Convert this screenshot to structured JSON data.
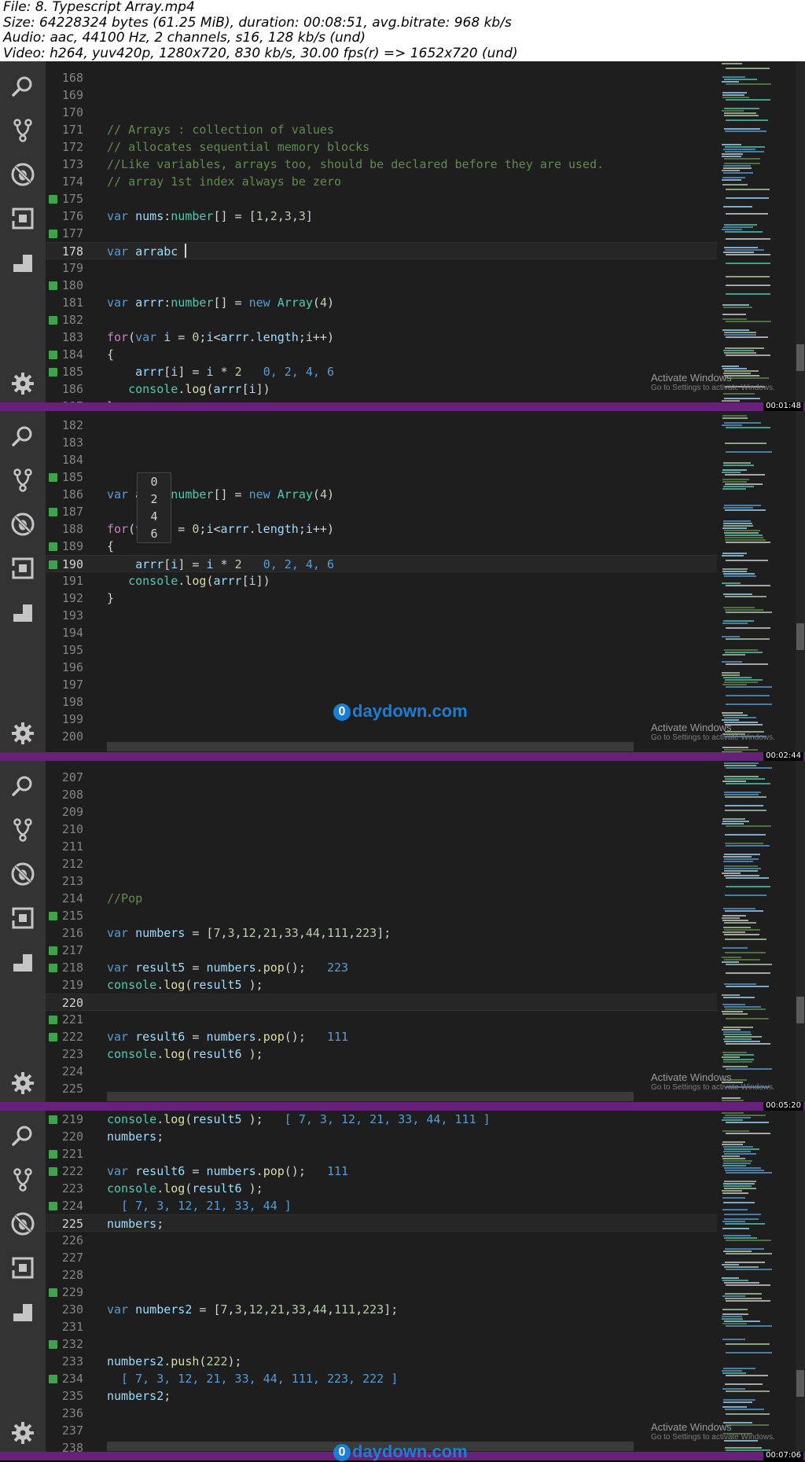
{
  "file_info": [
    "File: 8. Typescript Array.mp4",
    "Size: 64228324 bytes (61.25 MiB), duration: 00:08:51, avg.bitrate: 968 kb/s",
    "Audio: aac, 44100 Hz, 2 channels, s16, 128 kb/s (und)",
    "Video: h264, yuv420p, 1280x720, 830 kb/s, 30.00 fps(r) => 1652x720 (und)"
  ],
  "activity_icons": [
    "explorer-icon",
    "source-control-icon",
    "debug-icon",
    "extensions-icon",
    "layout-icon",
    "settings-icon"
  ],
  "watermark": {
    "line1": "Activate Windows",
    "line2": "Go to Settings to activate Windows."
  },
  "site_logo": {
    "mark": "0",
    "text": "daydown.com"
  },
  "panels": [
    {
      "timestamp": "00:01:48",
      "lines": [
        {
          "n": "168",
          "m": false,
          "t": ""
        },
        {
          "n": "169",
          "m": false,
          "t": ""
        },
        {
          "n": "170",
          "m": false,
          "t": ""
        },
        {
          "n": "171",
          "m": false,
          "t": "// Arrays : collection of values"
        },
        {
          "n": "172",
          "m": false,
          "t": "// allocates sequential memory blocks"
        },
        {
          "n": "173",
          "m": false,
          "t": "//Like variables, arrays too, should be declared before they are used."
        },
        {
          "n": "174",
          "m": false,
          "t": "// array 1st index always be zero"
        },
        {
          "n": "175",
          "m": true,
          "t": ""
        },
        {
          "n": "176",
          "m": false,
          "t": "var nums:number[] = [1,2,3,3]"
        },
        {
          "n": "177",
          "m": true,
          "t": ""
        },
        {
          "n": "178",
          "m": false,
          "t": "var arrabc "
        },
        {
          "n": "179",
          "m": false,
          "t": ""
        },
        {
          "n": "180",
          "m": true,
          "t": ""
        },
        {
          "n": "181",
          "m": false,
          "t": "var arrr:number[] = new Array(4)"
        },
        {
          "n": "182",
          "m": true,
          "t": ""
        },
        {
          "n": "183",
          "m": false,
          "t": "for(var i = 0;i<arrr.length;i++)"
        },
        {
          "n": "184",
          "m": true,
          "t": "{"
        },
        {
          "n": "185",
          "m": true,
          "t": "    arrr[i] = i * 2",
          "r": "0, 2, 4, 6"
        },
        {
          "n": "186",
          "m": false,
          "t": "   console.log(arrr[i])"
        },
        {
          "n": "187",
          "m": false,
          "t": "}"
        }
      ]
    },
    {
      "timestamp": "00:02:44",
      "popup_values": [
        "0",
        "2",
        "4",
        "6"
      ],
      "lines": [
        {
          "n": "182",
          "m": false,
          "t": ""
        },
        {
          "n": "183",
          "m": false,
          "t": ""
        },
        {
          "n": "184",
          "m": false,
          "t": ""
        },
        {
          "n": "185",
          "m": true,
          "t": ""
        },
        {
          "n": "186",
          "m": false,
          "t": "var arrr:number[] = new Array(4)"
        },
        {
          "n": "187",
          "m": true,
          "t": ""
        },
        {
          "n": "188",
          "m": false,
          "t": "for(var i = 0;i<arrr.length;i++)"
        },
        {
          "n": "189",
          "m": true,
          "t": "{"
        },
        {
          "n": "190",
          "m": true,
          "t": "    arrr[i] = i * 2",
          "r": "0, 2, 4, 6"
        },
        {
          "n": "191",
          "m": false,
          "t": "   console.log(arrr[i])"
        },
        {
          "n": "192",
          "m": false,
          "t": "}"
        },
        {
          "n": "193",
          "m": false,
          "t": ""
        },
        {
          "n": "194",
          "m": false,
          "t": ""
        },
        {
          "n": "195",
          "m": false,
          "t": ""
        },
        {
          "n": "196",
          "m": false,
          "t": ""
        },
        {
          "n": "197",
          "m": false,
          "t": ""
        },
        {
          "n": "198",
          "m": false,
          "t": ""
        },
        {
          "n": "199",
          "m": false,
          "t": ""
        },
        {
          "n": "200",
          "m": false,
          "t": ""
        }
      ]
    },
    {
      "timestamp": "00:05:20",
      "lines": [
        {
          "n": "207",
          "m": false,
          "t": ""
        },
        {
          "n": "208",
          "m": false,
          "t": ""
        },
        {
          "n": "209",
          "m": false,
          "t": ""
        },
        {
          "n": "210",
          "m": false,
          "t": ""
        },
        {
          "n": "211",
          "m": false,
          "t": ""
        },
        {
          "n": "212",
          "m": false,
          "t": ""
        },
        {
          "n": "213",
          "m": false,
          "t": ""
        },
        {
          "n": "214",
          "m": false,
          "t": "//Pop"
        },
        {
          "n": "215",
          "m": true,
          "t": ""
        },
        {
          "n": "216",
          "m": false,
          "t": "var numbers = [7,3,12,21,33,44,111,223];"
        },
        {
          "n": "217",
          "m": true,
          "t": ""
        },
        {
          "n": "218",
          "m": true,
          "t": "var result5 = numbers.pop();",
          "r": "223"
        },
        {
          "n": "219",
          "m": false,
          "t": "console.log(result5 );"
        },
        {
          "n": "220",
          "m": false,
          "t": ""
        },
        {
          "n": "221",
          "m": true,
          "t": ""
        },
        {
          "n": "222",
          "m": true,
          "t": "var result6 = numbers.pop();",
          "r": "111"
        },
        {
          "n": "223",
          "m": false,
          "t": "console.log(result6 );"
        },
        {
          "n": "224",
          "m": false,
          "t": ""
        },
        {
          "n": "225",
          "m": false,
          "t": ""
        }
      ]
    },
    {
      "timestamp": "00:07:06",
      "lines": [
        {
          "n": "219",
          "m": true,
          "t": "console.log(result5 );",
          "r": "[ 7, 3, 12, 21, 33, 44, 111 ]"
        },
        {
          "n": "220",
          "m": false,
          "t": "numbers;"
        },
        {
          "n": "221",
          "m": true,
          "t": ""
        },
        {
          "n": "222",
          "m": true,
          "t": "var result6 = numbers.pop();",
          "r": "111"
        },
        {
          "n": "223",
          "m": false,
          "t": "console.log(result6 );"
        },
        {
          "n": "224",
          "m": true,
          "t": "  [ 7, 3, 12, 21, 33, 44 ]",
          "res": true
        },
        {
          "n": "225",
          "m": false,
          "t": "numbers;"
        },
        {
          "n": "226",
          "m": false,
          "t": ""
        },
        {
          "n": "227",
          "m": false,
          "t": ""
        },
        {
          "n": "228",
          "m": false,
          "t": ""
        },
        {
          "n": "229",
          "m": true,
          "t": ""
        },
        {
          "n": "230",
          "m": false,
          "t": "var numbers2 = [7,3,12,21,33,44,111,223];"
        },
        {
          "n": "231",
          "m": false,
          "t": ""
        },
        {
          "n": "232",
          "m": true,
          "t": ""
        },
        {
          "n": "233",
          "m": false,
          "t": "numbers2.push(222);"
        },
        {
          "n": "234",
          "m": true,
          "t": "  [ 7, 3, 12, 21, 33, 44, 111, 223, 222 ]",
          "res": true
        },
        {
          "n": "235",
          "m": false,
          "t": "numbers2;"
        },
        {
          "n": "236",
          "m": false,
          "t": ""
        },
        {
          "n": "237",
          "m": false,
          "t": ""
        },
        {
          "n": "238",
          "m": false,
          "t": ""
        }
      ]
    }
  ]
}
